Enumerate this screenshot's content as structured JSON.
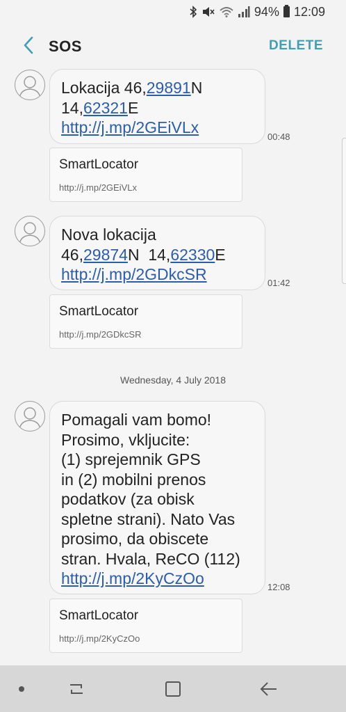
{
  "status_bar": {
    "battery": "94%",
    "time": "12:09",
    "icons": [
      "bluetooth-icon",
      "mute-icon",
      "wifi-icon",
      "signal-icon",
      "battery-icon"
    ]
  },
  "header": {
    "title": "SOS",
    "delete_label": "DELETE",
    "back_icon": "back-chevron-icon"
  },
  "messages": [
    {
      "prefix": "Lokacija  46,",
      "lat_link": "29891",
      "lat_suffix": "N",
      "lon_prefix": "14,",
      "lon_link": "62321",
      "lon_suffix": "E",
      "url": "http://j.mp/2GEiVLx",
      "time": "00:48",
      "preview": {
        "title": "SmartLocator",
        "url": "http://j.mp/2GEiVLx"
      }
    },
    {
      "line1": "Nova lokacija",
      "lat_prefix": "46,",
      "lat_link": "29874",
      "lat_suffix": "N  14,",
      "lon_link": "62330",
      "lon_suffix": "E",
      "url": "http://j.mp/2GDkcSR",
      "time": "01:42",
      "preview": {
        "title": "SmartLocator",
        "url": "http://j.mp/2GDkcSR"
      }
    },
    {
      "lines": [
        "Pomagali vam bomo!",
        "Prosimo, vkljucite:",
        "(1) sprejemnik GPS",
        "in (2) mobilni prenos",
        "podatkov (za obisk",
        "spletne strani). Nato Vas",
        "prosimo, da obiscete",
        "stran. Hvala, ReCO (112)"
      ],
      "url": "http://j.mp/2KyCzOo",
      "time": "12:08",
      "preview": {
        "title": "SmartLocator",
        "url": "http://j.mp/2KyCzOo"
      }
    }
  ],
  "date_divider": "Wednesday, 4 July 2018",
  "nav_bar": {
    "icons": [
      "nav-dot-icon",
      "recents-icon",
      "home-icon",
      "back-arrow-icon"
    ]
  },
  "colors": {
    "accent": "#3f9fb4",
    "link": "#2a5db0",
    "background": "#f3f3f3",
    "nav_background": "#d7d7d7"
  }
}
